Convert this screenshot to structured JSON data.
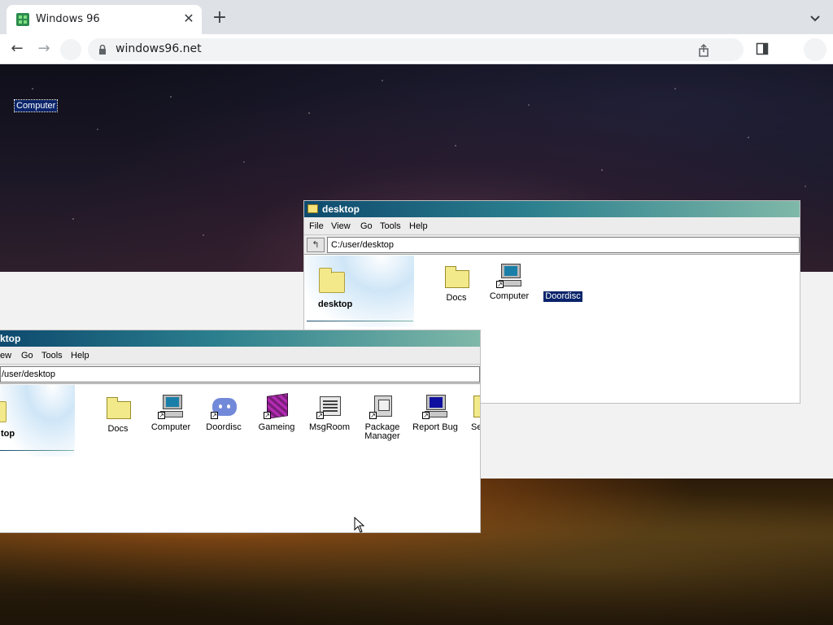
{
  "browser": {
    "tab_title": "Windows 96",
    "new_tab_label": "+",
    "url": "windows96.net"
  },
  "desktop": {
    "computer_label": "Computer"
  },
  "window_back": {
    "title": "desktop",
    "menu": [
      "File",
      "View",
      "Go",
      "Tools",
      "Help"
    ],
    "address": "C:/user/desktop",
    "side_title": "desktop",
    "items": [
      {
        "label": "Docs",
        "icon": "folder-icon"
      },
      {
        "label": "Computer",
        "icon": "computer-icon"
      },
      {
        "label": "Doordisc",
        "icon": "discord-icon",
        "selected": true
      }
    ]
  },
  "window_front": {
    "title": "ktop",
    "menu": [
      "ew",
      "Go",
      "Tools",
      "Help"
    ],
    "address": "/user/desktop",
    "side_title": "top",
    "items": [
      {
        "label": "Docs",
        "icon": "folder-icon"
      },
      {
        "label": "Computer",
        "icon": "computer-icon"
      },
      {
        "label": "Doordisc",
        "icon": "discord-icon"
      },
      {
        "label": "Gameing",
        "icon": "cube-icon"
      },
      {
        "label": "MsgRoom",
        "icon": "chat-icon"
      },
      {
        "label": "Package Manager",
        "icon": "package-icon"
      },
      {
        "label": "Report Bug",
        "icon": "bug-report-icon"
      },
      {
        "label": "Se",
        "icon": "settings-icon"
      }
    ]
  },
  "colors": {
    "titlebar_start": "#0e4a6e",
    "titlebar_end": "#7fb8a8",
    "selection": "#0a246a"
  }
}
